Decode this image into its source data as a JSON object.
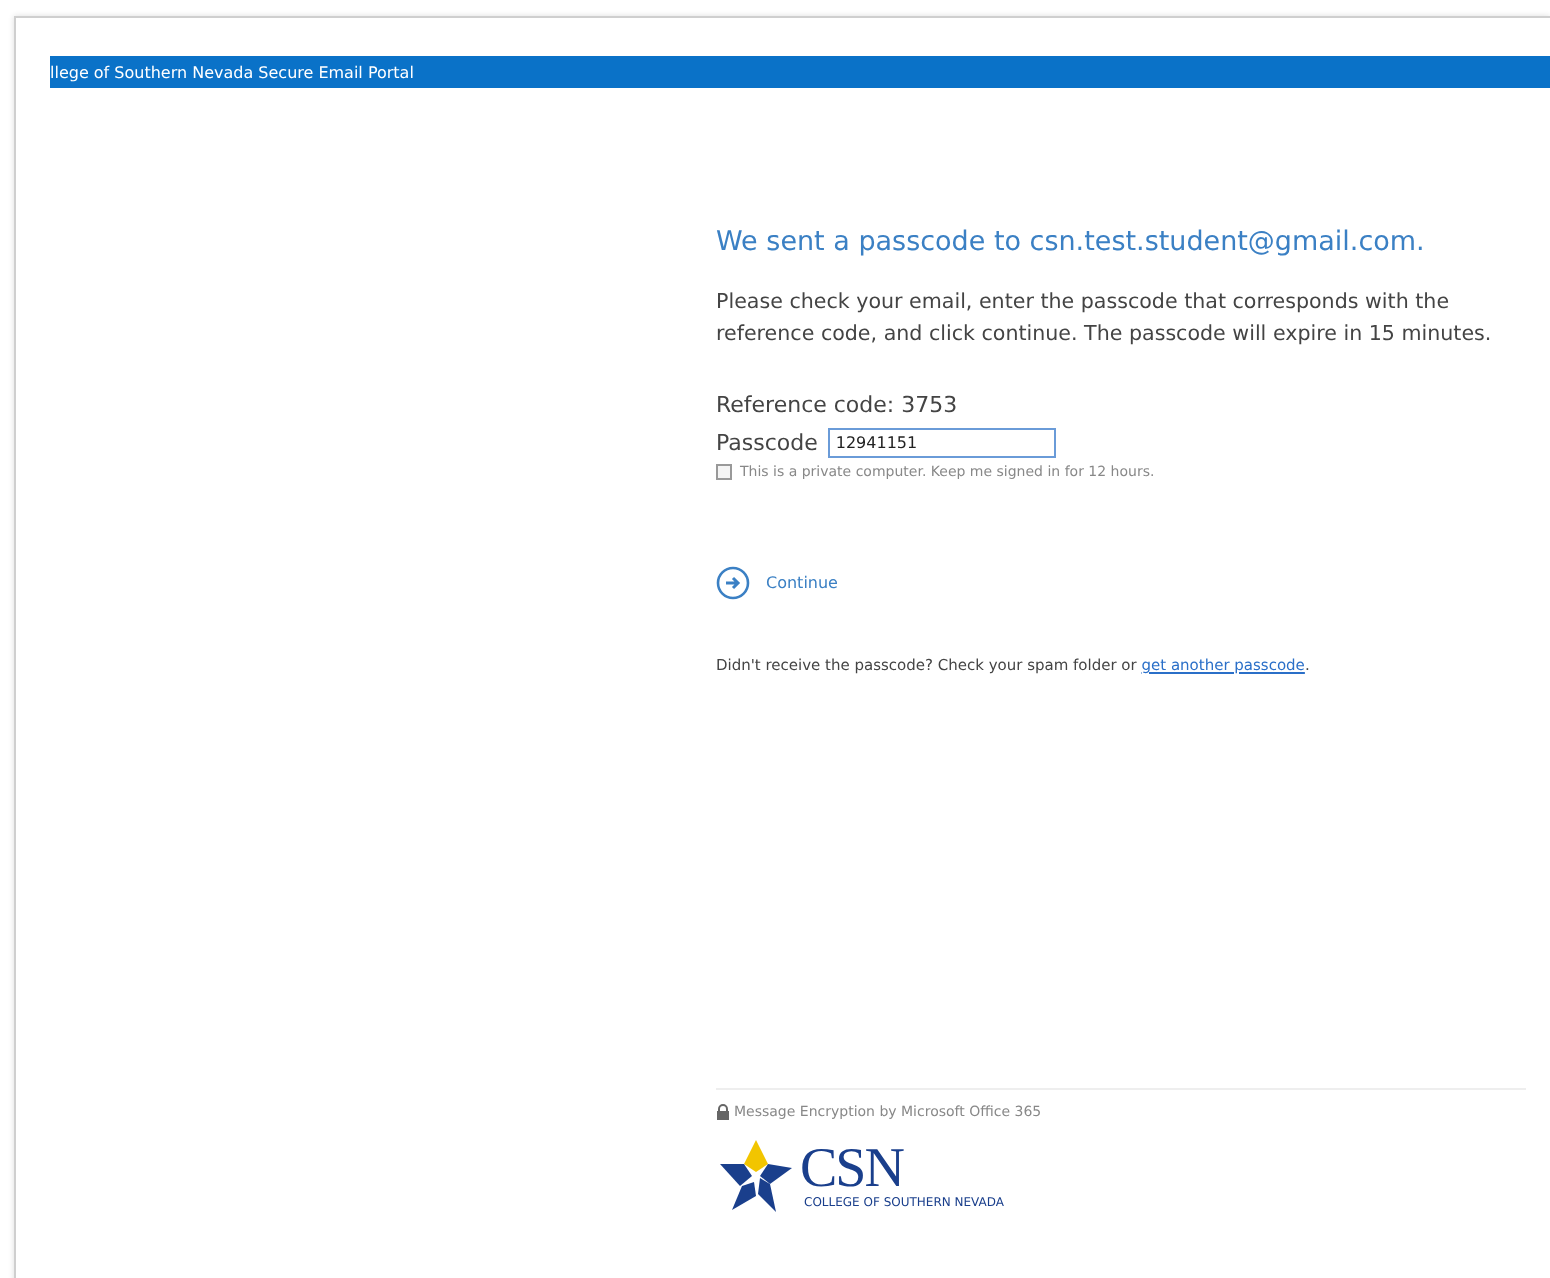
{
  "header": {
    "title": "llege of Southern Nevada Secure Email Portal"
  },
  "heading": "We sent a passcode to csn.test.student@gmail.com.",
  "instructions": "Please check your email, enter the passcode that corresponds with the reference code, and click continue. The passcode will expire in 15 minutes.",
  "reference_code": "Reference code: 3753",
  "passcode": {
    "label": "Passcode",
    "value": "12941151"
  },
  "keep_signed_in": {
    "label": "This is a private computer. Keep me signed in for 12 hours.",
    "checked": false
  },
  "continue_button": "Continue",
  "resend": {
    "text": "Didn't receive the passcode? Check your spam folder or ",
    "link": "get another passcode",
    "after": "."
  },
  "footer": {
    "text": "Message Encryption by Microsoft Office 365",
    "logo": "CSN",
    "logo_subtitle": "COLLEGE OF SOUTHERN NEVADA"
  }
}
